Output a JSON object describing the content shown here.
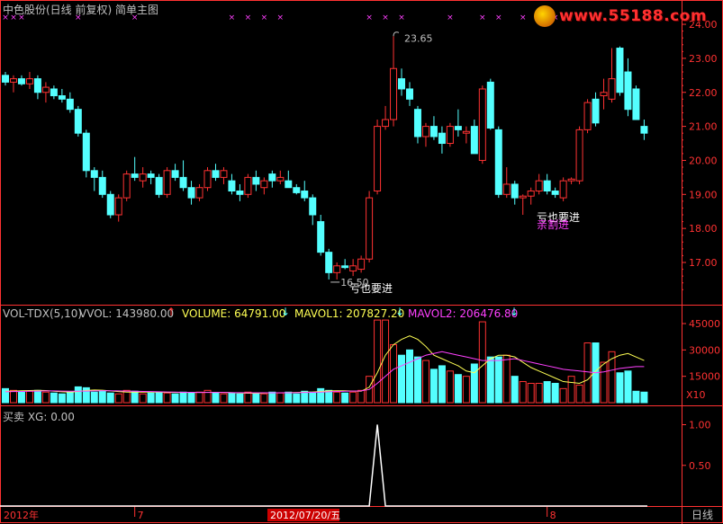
{
  "header": {
    "title": "中色股份(日线 前复权) 简单主图",
    "vol_line": {
      "label": "VOL-TDX(5,10)",
      "vvol": "VVOL: 143980.00",
      "volume": "VOLUME: 64791.00",
      "mavol1": "MAVOL1: 207827.20",
      "mavol2": "MAVOL2: 206476.80"
    },
    "sig_line": "买卖  XG: 0.00"
  },
  "watermark": "www.55188.com",
  "colors": {
    "up": "#ff3232",
    "down": "#54ffff",
    "mavol1": "#ffff54",
    "mavol2": "#ff40ff",
    "signal": "#ffffff",
    "axis": "#ff3232",
    "marker": "#ff40ff"
  },
  "chart_data": {
    "type": "candlestick",
    "price_axis": {
      "ticks": [
        17,
        18,
        19,
        20,
        21,
        22,
        23,
        24
      ]
    },
    "volume_axis": {
      "ticks": [
        15000,
        30000,
        45000
      ],
      "labels": [
        "15000",
        "30000",
        "45000"
      ],
      "unit": "X10"
    },
    "signal_axis": {
      "ticks": [
        0.5,
        1.0
      ],
      "labels": [
        "0.50",
        "1.00"
      ]
    },
    "x_labels": [
      "2012年",
      "7",
      "2012/07/20/五",
      "8"
    ],
    "period_label": "日线",
    "annotations": [
      "23.65",
      "16.50",
      "亏也要进",
      "亏也要进",
      "亲割进"
    ],
    "candles": [
      [
        22.5,
        22.6,
        22.2,
        22.3
      ],
      [
        22.3,
        22.5,
        22.0,
        22.4
      ],
      [
        22.4,
        22.5,
        22.2,
        22.25
      ],
      [
        22.25,
        22.6,
        22.1,
        22.4
      ],
      [
        22.4,
        22.5,
        21.8,
        22.0
      ],
      [
        22.0,
        22.3,
        21.7,
        22.15
      ],
      [
        22.1,
        22.2,
        21.8,
        21.9
      ],
      [
        21.9,
        22.1,
        21.7,
        21.8
      ],
      [
        21.8,
        22.0,
        21.4,
        21.5
      ],
      [
        21.5,
        21.6,
        20.7,
        20.8
      ],
      [
        20.8,
        20.9,
        19.5,
        19.7
      ],
      [
        19.7,
        19.8,
        19.1,
        19.5
      ],
      [
        19.5,
        19.7,
        18.9,
        19.0
      ],
      [
        19.0,
        19.1,
        18.3,
        18.4
      ],
      [
        18.4,
        19.0,
        18.2,
        18.9
      ],
      [
        18.9,
        19.7,
        18.8,
        19.6
      ],
      [
        19.6,
        20.1,
        19.4,
        19.5
      ],
      [
        19.4,
        19.8,
        19.2,
        19.6
      ],
      [
        19.6,
        19.7,
        19.3,
        19.5
      ],
      [
        19.5,
        19.6,
        18.9,
        19.0
      ],
      [
        19.0,
        19.8,
        18.9,
        19.7
      ],
      [
        19.7,
        19.9,
        19.4,
        19.5
      ],
      [
        19.5,
        20.0,
        19.1,
        19.2
      ],
      [
        19.2,
        19.4,
        18.7,
        18.9
      ],
      [
        18.9,
        19.3,
        18.8,
        19.2
      ],
      [
        19.2,
        19.8,
        19.1,
        19.7
      ],
      [
        19.7,
        19.9,
        19.4,
        19.5
      ],
      [
        19.5,
        19.8,
        19.3,
        19.7
      ],
      [
        19.4,
        19.6,
        19.0,
        19.1
      ],
      [
        19.1,
        19.3,
        18.8,
        19.0
      ],
      [
        19.0,
        19.6,
        18.9,
        19.5
      ],
      [
        19.5,
        19.7,
        19.1,
        19.3
      ],
      [
        19.2,
        19.5,
        19.0,
        19.4
      ],
      [
        19.6,
        19.7,
        19.2,
        19.4
      ],
      [
        19.4,
        19.7,
        19.3,
        19.5
      ],
      [
        19.4,
        19.7,
        19.3,
        19.2
      ],
      [
        19.2,
        19.3,
        19.0,
        19.05
      ],
      [
        19.1,
        19.4,
        18.8,
        18.9
      ],
      [
        18.9,
        19.0,
        18.1,
        18.4
      ],
      [
        18.2,
        18.4,
        17.2,
        17.3
      ],
      [
        17.3,
        17.4,
        16.5,
        16.7
      ],
      [
        16.7,
        17.0,
        16.5,
        16.9
      ],
      [
        16.9,
        17.1,
        16.8,
        16.85
      ],
      [
        16.75,
        17.1,
        16.6,
        16.9
      ],
      [
        16.8,
        17.2,
        16.7,
        17.1
      ],
      [
        17.1,
        19.1,
        17.0,
        18.9
      ],
      [
        19.1,
        21.2,
        19.0,
        21.0
      ],
      [
        21.0,
        21.6,
        20.9,
        21.2
      ],
      [
        21.2,
        23.65,
        21.0,
        22.7
      ],
      [
        22.4,
        22.7,
        21.9,
        22.1
      ],
      [
        22.1,
        22.3,
        21.6,
        21.8
      ],
      [
        21.5,
        21.6,
        20.5,
        20.7
      ],
      [
        20.7,
        21.1,
        20.4,
        21.0
      ],
      [
        21.0,
        21.3,
        20.6,
        20.7
      ],
      [
        20.8,
        21.0,
        20.2,
        20.5
      ],
      [
        20.5,
        21.1,
        20.4,
        21.0
      ],
      [
        21.0,
        21.5,
        20.7,
        20.9
      ],
      [
        20.8,
        21.0,
        20.5,
        20.85
      ],
      [
        21.0,
        21.2,
        20.2,
        20.2
      ],
      [
        20.0,
        22.2,
        19.9,
        22.1
      ],
      [
        22.3,
        22.4,
        20.9,
        20.95
      ],
      [
        20.9,
        21.0,
        18.9,
        19.0
      ],
      [
        19.0,
        19.8,
        18.9,
        19.3
      ],
      [
        19.3,
        19.4,
        18.7,
        18.9
      ],
      [
        18.9,
        19.0,
        18.4,
        18.95
      ],
      [
        18.95,
        19.2,
        18.7,
        19.1
      ],
      [
        19.1,
        19.6,
        19.0,
        19.4
      ],
      [
        19.4,
        19.6,
        19.0,
        19.1
      ],
      [
        19.1,
        19.2,
        18.9,
        19.0
      ],
      [
        18.9,
        19.5,
        18.8,
        19.4
      ],
      [
        19.4,
        19.5,
        19.3,
        19.45
      ],
      [
        19.4,
        21.0,
        19.3,
        20.9
      ],
      [
        20.9,
        21.8,
        20.8,
        21.7
      ],
      [
        21.8,
        22.0,
        21.0,
        21.1
      ],
      [
        21.9,
        22.4,
        21.5,
        22.0
      ],
      [
        21.8,
        23.3,
        21.7,
        22.4
      ],
      [
        23.3,
        23.35,
        21.9,
        22.0
      ],
      [
        22.6,
        23.0,
        21.3,
        21.5
      ],
      [
        22.1,
        22.2,
        21.4,
        21.2
      ],
      [
        21.0,
        21.2,
        20.6,
        20.8
      ]
    ],
    "volume": [
      8000,
      7000,
      6000,
      6500,
      7000,
      6000,
      5500,
      5000,
      6000,
      9000,
      8500,
      6000,
      6500,
      5500,
      5000,
      7000,
      6500,
      5000,
      5500,
      6000,
      5500,
      5000,
      6000,
      5500,
      6000,
      7000,
      5500,
      5000,
      5500,
      5000,
      6000,
      5500,
      5000,
      6000,
      5500,
      6000,
      5000,
      6500,
      6000,
      8000,
      7000,
      6000,
      5500,
      6000,
      7000,
      15000,
      47000,
      47000,
      33000,
      27000,
      30000,
      26000,
      24000,
      19000,
      21000,
      18000,
      16000,
      15000,
      22000,
      46000,
      26000,
      26000,
      27000,
      15000,
      12000,
      11000,
      11000,
      12000,
      11000,
      8000,
      15000,
      10000,
      34000,
      34000,
      23000,
      29000,
      17000,
      18000,
      6500,
      6000
    ],
    "mavol1": [
      6500,
      6600,
      6800,
      6900,
      7000,
      6900,
      6500,
      6200,
      6000,
      6300,
      7000,
      7200,
      7100,
      6700,
      6300,
      6000,
      6000,
      6000,
      6100,
      6000,
      5900,
      5800,
      5800,
      5800,
      5800,
      5900,
      5900,
      5800,
      5700,
      5500,
      5400,
      5400,
      5500,
      5600,
      5600,
      5700,
      5800,
      6000,
      6100,
      6400,
      6700,
      6800,
      6800,
      6600,
      6500,
      8800,
      17000,
      27000,
      33000,
      36000,
      38000,
      36000,
      32000,
      27000,
      25000,
      23000,
      21000,
      18000,
      17000,
      21000,
      25000,
      27000,
      27000,
      26000,
      23000,
      20000,
      18000,
      16000,
      14000,
      12000,
      11500,
      11000,
      13000,
      18000,
      22000,
      25000,
      27000,
      28000,
      26000,
      24000
    ],
    "mavol2": [
      6200,
      6300,
      6400,
      6500,
      6600,
      6700,
      6700,
      6600,
      6500,
      6500,
      6600,
      6700,
      6800,
      6800,
      6700,
      6600,
      6500,
      6400,
      6300,
      6200,
      6100,
      6000,
      5900,
      5900,
      5800,
      5800,
      5800,
      5800,
      5700,
      5700,
      5600,
      5600,
      5600,
      5600,
      5600,
      5600,
      5700,
      5800,
      5900,
      6000,
      6200,
      6400,
      6500,
      6600,
      6700,
      7500,
      11000,
      15000,
      19000,
      21000,
      23000,
      25000,
      27000,
      28000,
      29000,
      28000,
      27000,
      26000,
      25000,
      24000,
      24000,
      24000,
      24500,
      25000,
      24000,
      23000,
      22000,
      21000,
      20000,
      19000,
      18500,
      18000,
      17500,
      17000,
      17500,
      18500,
      19500,
      20000,
      20500,
      20500
    ],
    "signal_peak_index": 46
  }
}
